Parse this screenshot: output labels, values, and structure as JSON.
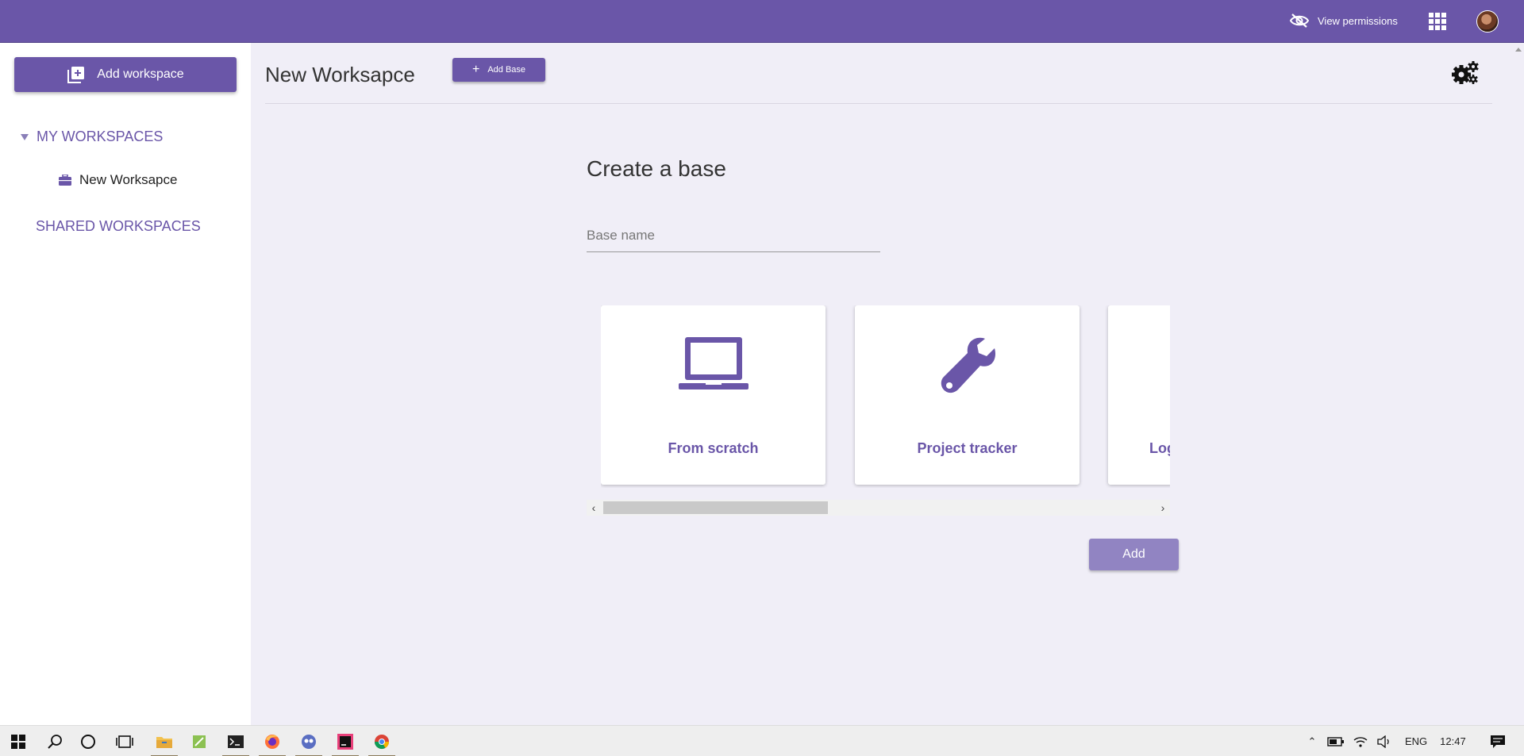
{
  "topbar": {
    "view_permissions": "View permissions",
    "accent": "#6a56a8"
  },
  "sidebar": {
    "add_workspace": "Add workspace",
    "my_workspaces": "MY WORKSPACES",
    "workspaces": [
      {
        "label": "New Worksapce",
        "icon": "briefcase-icon"
      }
    ],
    "shared_workspaces": "SHARED WORKSPACES"
  },
  "main": {
    "title": "New Worksapce",
    "add_base": "Add Base",
    "create_title": "Create a base",
    "base_name_placeholder": "Base name",
    "templates": [
      {
        "label": "From scratch",
        "icon": "laptop-icon"
      },
      {
        "label": "Project tracker",
        "icon": "wrench-icon"
      },
      {
        "label": "Log",
        "icon": ""
      }
    ],
    "add_button": "Add"
  },
  "taskbar": {
    "language": "ENG",
    "time": "12:47"
  }
}
